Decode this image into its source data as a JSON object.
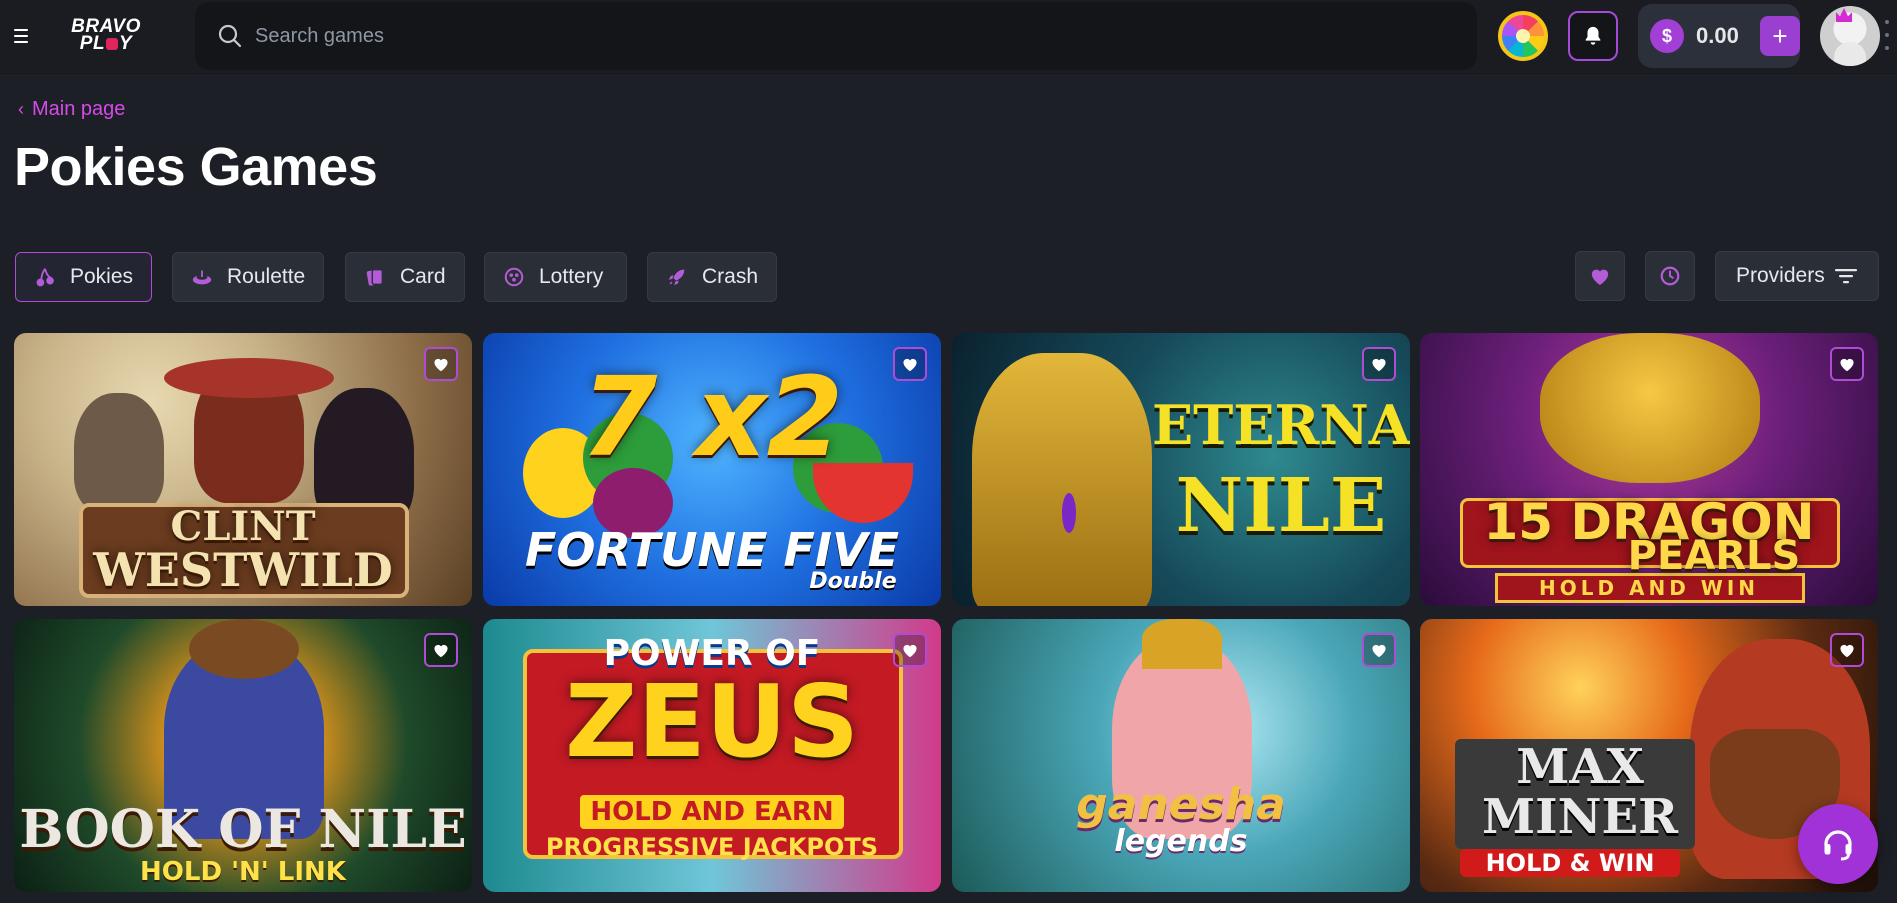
{
  "header": {
    "logo_line1": "BRAVO",
    "logo_line2a": "PL",
    "logo_line2b": "Y",
    "search_placeholder": "Search games",
    "balance": "0.00",
    "currency_symbol": "$",
    "deposit_label": "+"
  },
  "breadcrumb": {
    "label": "Main page"
  },
  "page_title": "Pokies Games",
  "tabs": [
    {
      "label": "Pokies",
      "icon": "cherries-icon",
      "active": true
    },
    {
      "label": "Roulette",
      "icon": "roulette-icon",
      "active": false
    },
    {
      "label": "Card",
      "icon": "cards-icon",
      "active": false
    },
    {
      "label": "Lottery",
      "icon": "lottery-ball-icon",
      "active": false
    },
    {
      "label": "Crash",
      "icon": "rocket-icon",
      "active": false
    }
  ],
  "filters": {
    "favorites_icon": "heart-icon",
    "recent_icon": "history-icon",
    "providers_label": "Providers",
    "providers_icon": "filter-icon"
  },
  "games": [
    {
      "title_line1": "CLINT",
      "title_line2": "WESTWILD",
      "subtitle": ""
    },
    {
      "title_line1": "7 x2",
      "title_line2": "FORTUNE FIVE",
      "subtitle": "Double"
    },
    {
      "title_line1": "ETERNAL",
      "title_line2": "NILE",
      "subtitle": ""
    },
    {
      "title_line1": "15 DRAGON",
      "title_line2": "PEARLS",
      "subtitle": "HOLD AND WIN"
    },
    {
      "title_line1": "BOOK OF NILE",
      "title_line2": "",
      "subtitle": "HOLD 'N' LINK"
    },
    {
      "title_line1": "POWER OF",
      "title_line2": "ZEUS",
      "subtitle": "HOLD AND EARN",
      "subtitle2": "PROGRESSIVE JACKPOTS"
    },
    {
      "title_line1": "ganesha",
      "title_line2": "legends",
      "subtitle": ""
    },
    {
      "title_line1": "MAX",
      "title_line2": "MINER",
      "subtitle": "HOLD & WIN"
    }
  ],
  "colors": {
    "accent": "#a23fd6",
    "accent_text": "#d54be8",
    "background": "#1c1f26",
    "header_bg": "#1a1c22"
  }
}
